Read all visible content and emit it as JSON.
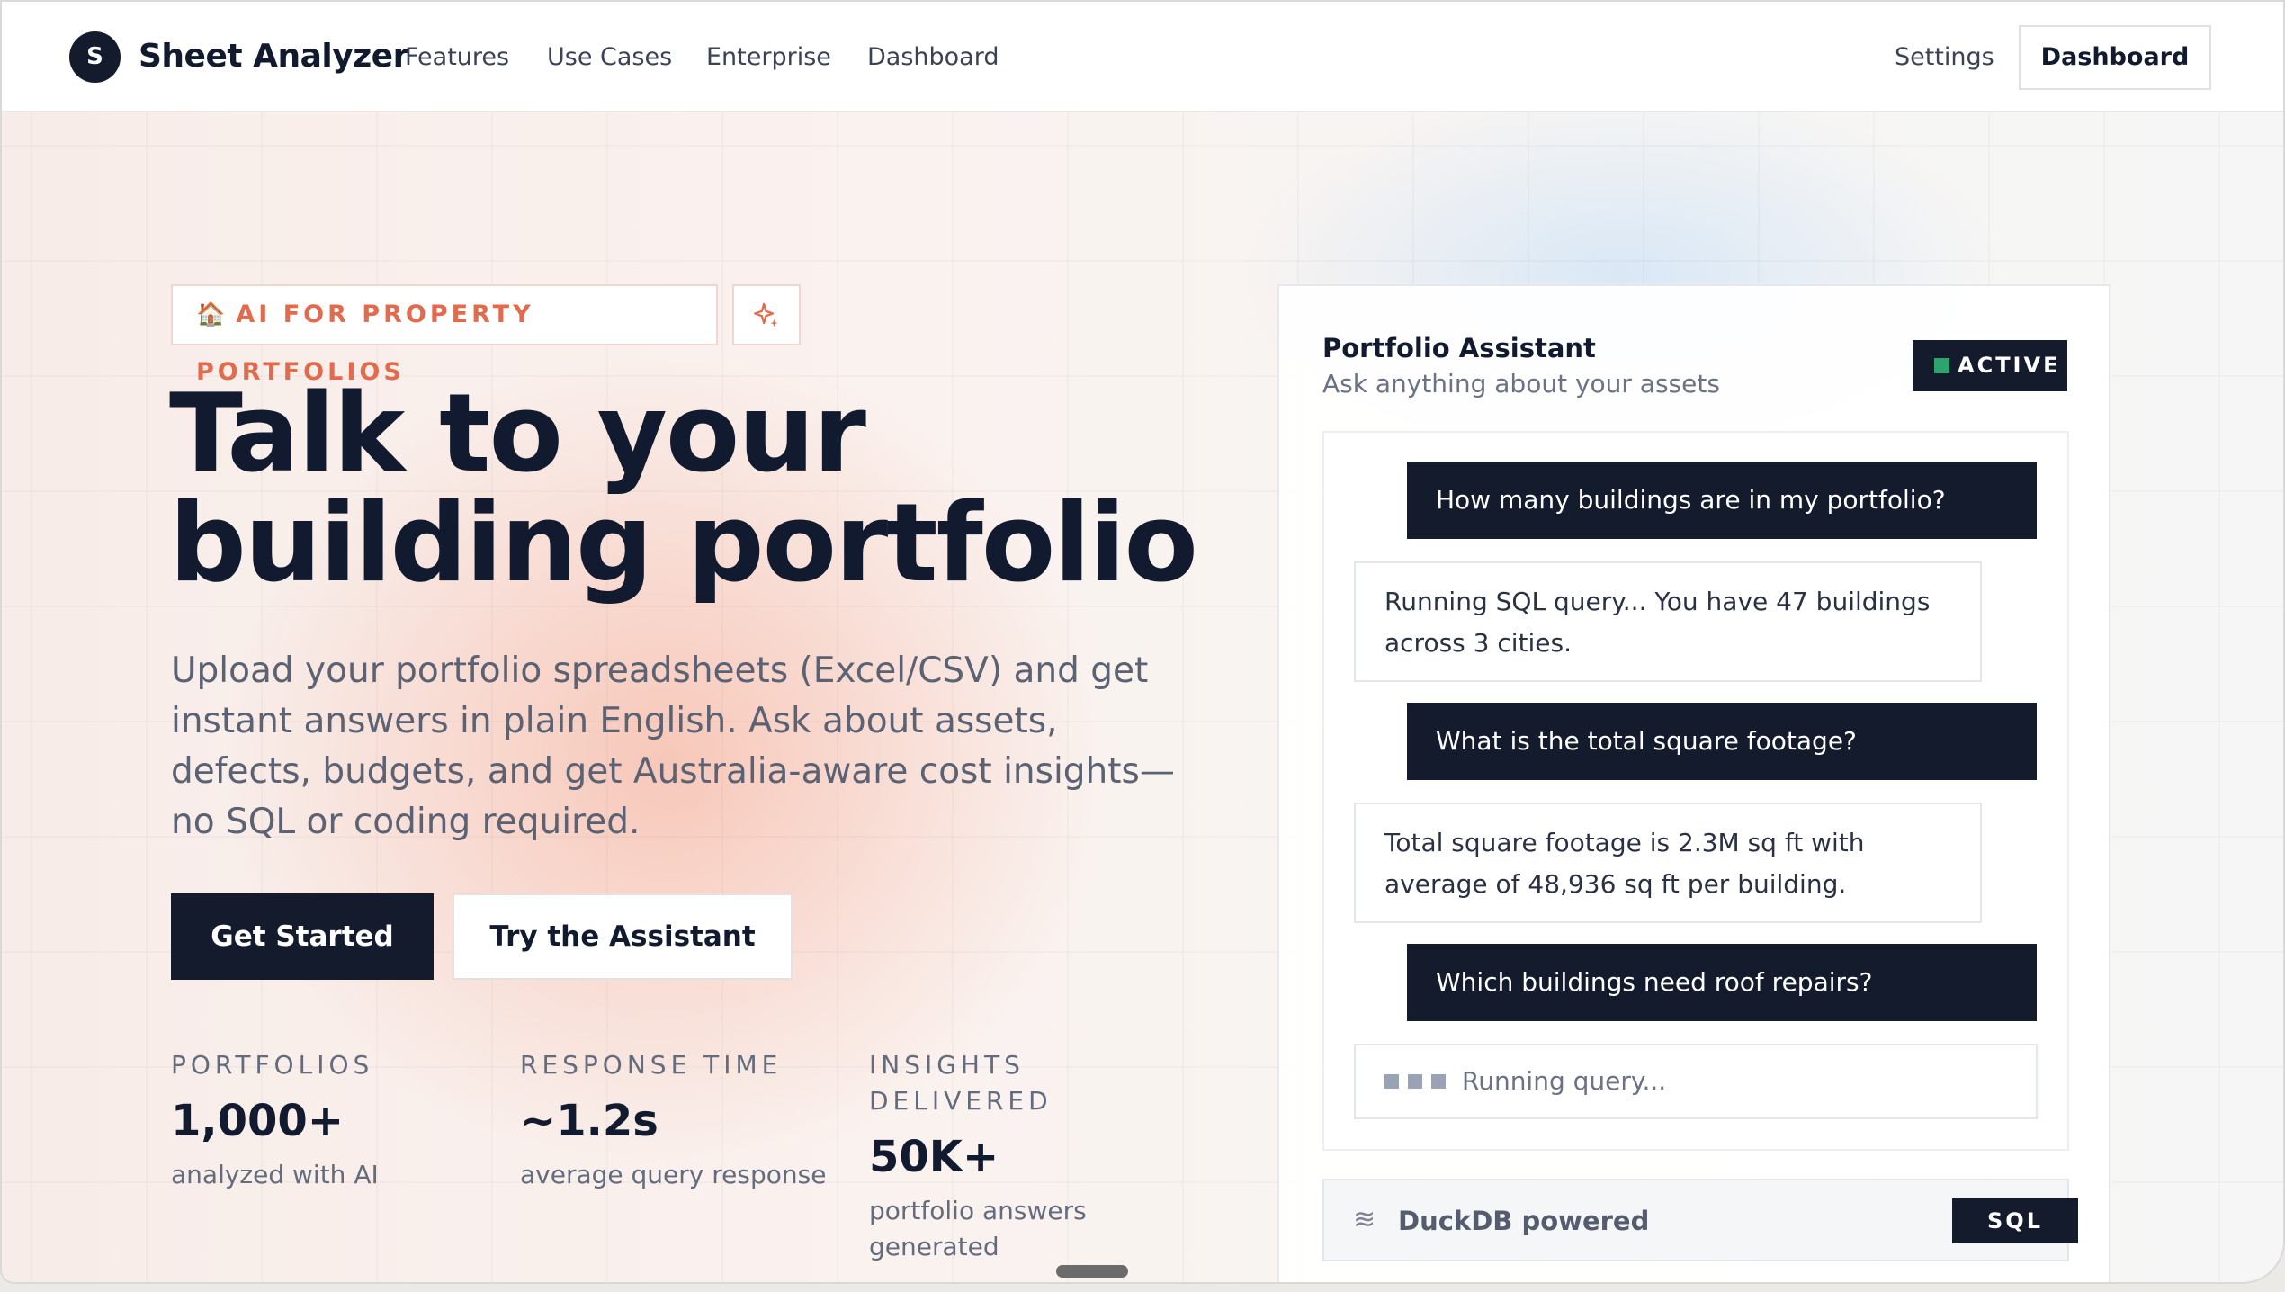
{
  "nav": {
    "logo_letter": "S",
    "brand": "Sheet Analyzer",
    "links": [
      "Features",
      "Use Cases",
      "Enterprise",
      "Dashboard"
    ],
    "settings": "Settings",
    "dashboard_button": "Dashboard"
  },
  "hero": {
    "badge_icon": "house-icon",
    "badge_text": "AI FOR PROPERTY PORTFOLIOS",
    "sparkle_icon": "sparkle-icon",
    "headline_line1": "Talk to your",
    "headline_line2": "building portfolio",
    "subtitle": "Upload your portfolio spreadsheets (Excel/CSV) and get instant answers in plain English. Ask about assets, defects, budgets, and get Australia-aware cost insights—no SQL or coding required.",
    "primary_button": "Get Started",
    "secondary_button": "Try the Assistant"
  },
  "stats": [
    {
      "label": "PORTFOLIOS",
      "value": "1,000+",
      "desc": "analyzed with AI"
    },
    {
      "label": "RESPONSE TIME",
      "value": "~1.2s",
      "desc": "average query response"
    },
    {
      "label": "INSIGHTS DELIVERED",
      "value": "50K+",
      "desc": "portfolio answers generated"
    }
  ],
  "assistant": {
    "title": "Portfolio Assistant",
    "subtitle": "Ask anything about your assets",
    "status": "ACTIVE",
    "status_color": "#2ea36e",
    "messages": [
      {
        "role": "user",
        "text": "How many buildings are in my portfolio?"
      },
      {
        "role": "assistant",
        "text": "Running SQL query... You have 47 buildings across 3 cities."
      },
      {
        "role": "user",
        "text": "What is the total square footage?"
      },
      {
        "role": "assistant",
        "text": "Total square footage is 2.3M sq ft with average of 48,936 sq ft per building."
      },
      {
        "role": "user",
        "text": "Which buildings need roof repairs?"
      }
    ],
    "loading_text": "Running query...",
    "footer_icon": "waves-icon",
    "footer_label": "DuckDB powered",
    "footer_badge": "SQL"
  },
  "colors": {
    "dark": "#141b2c",
    "accent": "#e26a4d"
  }
}
